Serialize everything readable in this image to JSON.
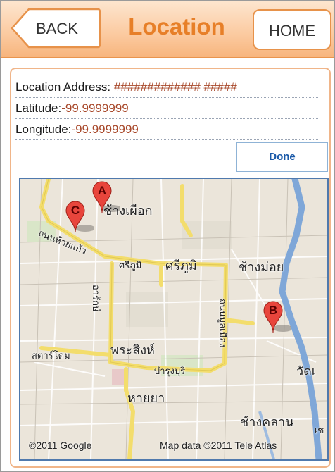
{
  "header": {
    "back_label": "BACK",
    "title": "Location",
    "home_label": "HOME"
  },
  "info": {
    "address_label": "Location Address:",
    "address_value": "############# #####",
    "latitude_label": "Latitude:",
    "latitude_value": "-99.9999999",
    "longitude_label": "Longitude:",
    "longitude_value": "-99.9999999"
  },
  "done_label": "Done",
  "map": {
    "markers": [
      {
        "label": "A"
      },
      {
        "label": "B"
      },
      {
        "label": "C"
      }
    ],
    "place_labels": {
      "chang_phueak": "ช้างเผือก",
      "thanon_huay_kaew": "ถนนห้วยแก้ว",
      "sriphum_small": "ศรีภูมิ",
      "sriphum": "ศรีภูมิ",
      "chang_moi": "ช้างม่อย",
      "arak": "อารักษ์",
      "mun_mueang": "ถนนมูลเมือง",
      "stadium": "สตาร์โดม",
      "phra_sing": "พระสิงห์",
      "bamrung_buri": "บำรุงบุรี",
      "hai_ya": "หายยา",
      "wat_ket": "วัดเ",
      "chang_khlan": "ช้างคลาน",
      "wiang": "เซ"
    },
    "attribution_google": "©2011 Google",
    "attribution_data": "Map data ©2011 Tele Atlas",
    "colors": {
      "road_major": "#f5e27a",
      "river": "#7fa7d8",
      "marker": "#e8453c"
    }
  }
}
